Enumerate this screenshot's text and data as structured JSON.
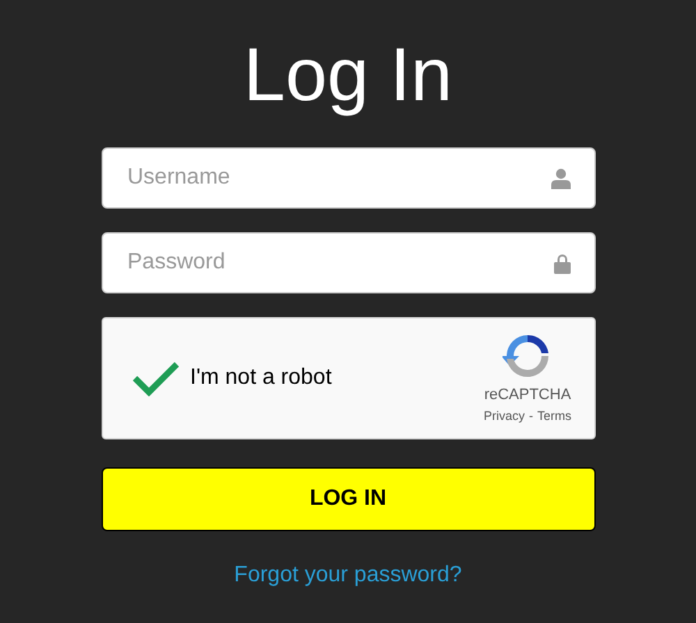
{
  "title": "Log In",
  "fields": [
    {
      "placeholder": "Username",
      "kind": "user"
    },
    {
      "placeholder": "Password",
      "kind": "lock"
    }
  ],
  "captcha": {
    "checked": true,
    "label": "I'm not a robot",
    "brand": "reCAPTCHA",
    "privacy": "Privacy",
    "separator": "-",
    "terms": "Terms"
  },
  "login_button": "LOG IN",
  "forgot_link": "Forgot your password?"
}
